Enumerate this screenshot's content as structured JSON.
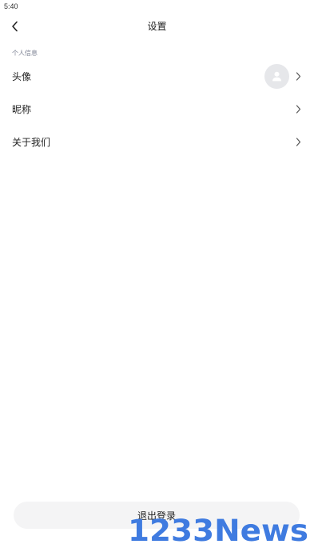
{
  "status_bar": {
    "time": "5:40"
  },
  "nav": {
    "title": "设置"
  },
  "section": {
    "header": "个人信息"
  },
  "items": [
    {
      "label": "头像"
    },
    {
      "label": "昵称"
    },
    {
      "label": "关于我们"
    }
  ],
  "logout": {
    "label": "退出登录"
  },
  "watermark": {
    "text": "1233News"
  },
  "colors": {
    "watermark": "#3f7be0",
    "section_header": "#7b8092",
    "avatar_bg": "#e6e7ea",
    "button_bg": "#f4f4f5"
  },
  "icons": {
    "back": "chevron-left-icon",
    "row_arrow": "chevron-right-icon",
    "avatar": "user-placeholder-icon"
  }
}
